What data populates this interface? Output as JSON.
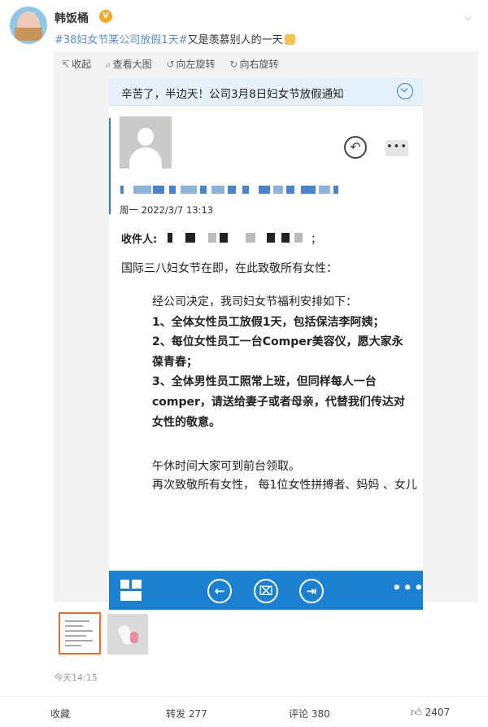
{
  "post": {
    "username": "韩饭桶",
    "verified_badge": "V",
    "hashtag": "#38妇女节某公司放假1天#",
    "text": "又是羡慕别人的一天",
    "timestamp": "今天14:15"
  },
  "toolbar": {
    "collapse": "收起",
    "view_large": "查看大图",
    "rotate_left": "向左旋转",
    "rotate_right": "向右旋转"
  },
  "email": {
    "subject": "辛苦了，半边天！公司3月8日妇女节放假通知",
    "date": "周一 2022/3/7 13:13",
    "to_label": "收件人:",
    "to_suffix": "；",
    "greeting": "国际三八妇女节在即，在此致敬所有女性：",
    "intro": "经公司决定，我司妇女节福利安排如下：",
    "item1": "1、全体女性员工放假1天，包括保洁李阿姨；",
    "item2": "2、每位女性员工一台Comper美容仪，愿大家永葆青春；",
    "item3": "3、全体男性员工照常上班，但同样每人一台comper，请送给妻子或者母亲，代替我们传达对女性的敬意。",
    "pickup": "午休时间大家可到前台领取。",
    "closing": "再次致敬所有女性， 每1位女性拼搏者、妈妈 、女儿"
  },
  "actions": {
    "favorite": "收藏",
    "repost": "转发 277",
    "comment": "评论 380",
    "like": "2407"
  },
  "colors": {
    "accent_blue": "#1b7fd2",
    "hashtag": "#5a8ec9",
    "thumb_border": "#f56b2a"
  }
}
